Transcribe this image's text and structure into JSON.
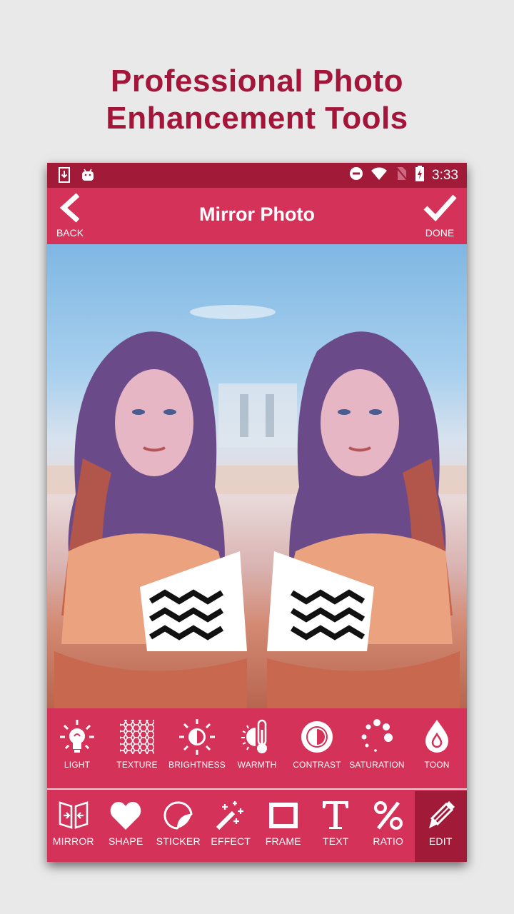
{
  "promo": {
    "line1": "Professional Photo",
    "line2": "Enhancement Tools",
    "color": "#a3163a"
  },
  "status_bar": {
    "left_icons": [
      "download-icon",
      "android-icon"
    ],
    "right_icons": [
      "do-not-disturb-icon",
      "wifi-icon",
      "no-sim-icon",
      "battery-charging-icon"
    ],
    "time": "3:33",
    "color": "#a11a38"
  },
  "app_bar": {
    "title": "Mirror Photo",
    "back_label": "BACK",
    "done_label": "DONE",
    "color": "#d5325a"
  },
  "adjustments": [
    {
      "label": "LIGHT",
      "icon": "lightbulb-icon"
    },
    {
      "label": "TEXTURE",
      "icon": "texture-icon"
    },
    {
      "label": "BRIGHTNESS",
      "icon": "brightness-icon"
    },
    {
      "label": "WARMTH",
      "icon": "thermometer-icon"
    },
    {
      "label": "CONTRAST",
      "icon": "contrast-icon"
    },
    {
      "label": "SATURATION",
      "icon": "saturation-icon"
    },
    {
      "label": "TOON",
      "icon": "drop-icon"
    }
  ],
  "tools": [
    {
      "label": "MIRROR",
      "icon": "mirror-icon"
    },
    {
      "label": "SHAPE",
      "icon": "heart-icon"
    },
    {
      "label": "STICKER",
      "icon": "sticker-icon"
    },
    {
      "label": "EFFECT",
      "icon": "magic-wand-icon"
    },
    {
      "label": "FRAME",
      "icon": "frame-icon"
    },
    {
      "label": "TEXT",
      "icon": "text-icon"
    },
    {
      "label": "RATIO",
      "icon": "percent-icon"
    },
    {
      "label": "EDIT",
      "icon": "pencil-icon",
      "active": true
    }
  ]
}
